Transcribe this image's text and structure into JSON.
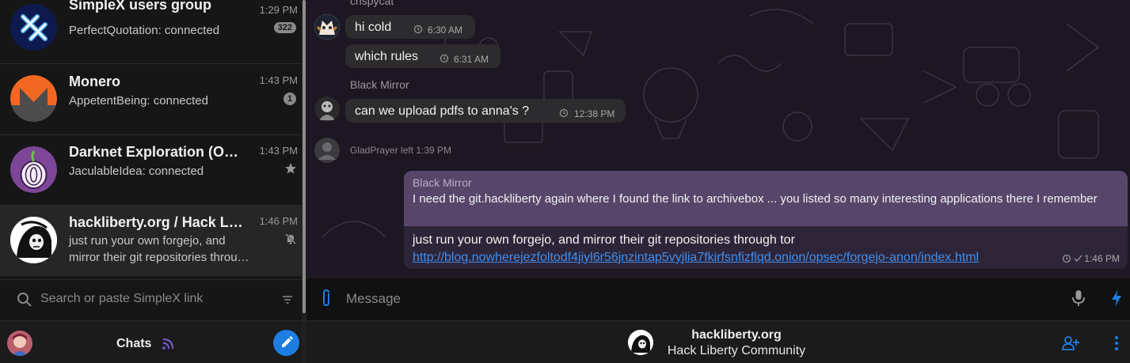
{
  "chats": [
    {
      "name": "SimpleX users group",
      "time": "1:29 PM",
      "preview_sender": "PerfectQuotation:",
      "preview_text": "connected",
      "badge": "322",
      "avatar_icon": "simplex-logo-icon"
    },
    {
      "name": "Monero",
      "time": "1:43 PM",
      "preview_sender": "AppetentBeing:",
      "preview_text": "connected",
      "badge": "1",
      "avatar_icon": "monero-logo-icon"
    },
    {
      "name": "Darknet Exploration (O…",
      "time": "1:43 PM",
      "preview_sender": "JaculableIdea:",
      "preview_text": "connected",
      "meta_icon": "star-icon",
      "avatar_icon": "tor-onion-icon"
    },
    {
      "name": "hackliberty.org / Hack L…",
      "time": "1:46 PM",
      "preview_line1": "just run your own forgejo, and",
      "preview_line2": "mirror their git repositories throu…",
      "meta_icon": "muted-bell-icon",
      "avatar_icon": "hackliberty-reaper-icon"
    }
  ],
  "search": {
    "placeholder": "Search or paste SimpleX link"
  },
  "left_footer": {
    "label": "Chats"
  },
  "messages": {
    "first_sender": "crispycat",
    "m1": {
      "text": "hi cold",
      "time": "6:30 AM"
    },
    "m2": {
      "text": "which rules",
      "time": "6:31 AM"
    },
    "second_sender": "Black Mirror",
    "m3": {
      "text": "can we upload pdfs to anna's ?",
      "time": "12:38 PM"
    },
    "system": "GladPrayer  left  1:39 PM",
    "reply": {
      "quote_sender": "Black Mirror",
      "quote_text": "I need the git.hackliberty again where I found the link to archivebox ... you listed so many interesting applications there I remember",
      "body": "just run your own forgejo, and mirror their git repositories through tor",
      "link": "http://blog.nowherejezfoltodf4jiyl6r56jnzintap5vyjlia7fkirfsnfizflqd.onion/opsec/forgejo-anon/index.html",
      "time": "1:46 PM"
    }
  },
  "composer": {
    "placeholder": "Message"
  },
  "header": {
    "title": "hackliberty.org",
    "subtitle": "Hack Liberty Community"
  },
  "colors": {
    "accent": "#1c7de3",
    "link": "#3d8ff0",
    "incoming_bubble": "#2c2c2e",
    "quote": "#58466a"
  }
}
